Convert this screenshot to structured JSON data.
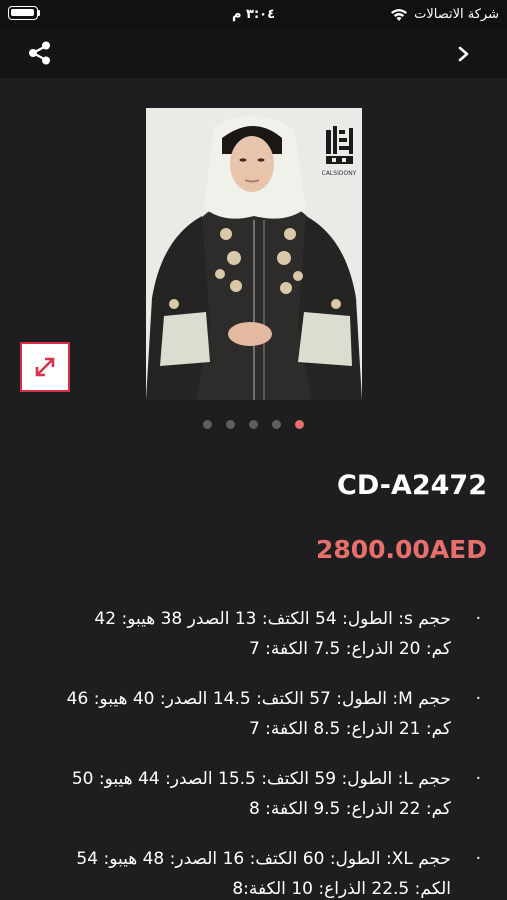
{
  "status_bar": {
    "carrier": "شركة الاتصالات",
    "time": "٣:٠٤ م"
  },
  "nav": {
    "back_icon": "chevron-right-icon",
    "share_icon": "share-icon"
  },
  "product": {
    "image_logo_text": "CALSIDONY",
    "carousel_pages": 5,
    "active_page": 5,
    "code": "CD-A2472",
    "price": "2800.00AED"
  },
  "sizes": [
    {
      "line1": "حجم s:  الطول: 54 الكتف: 13 الصدر 38 هيبو: 42",
      "line2": "كم: 20 الذراع: 7.5 الكفة: 7"
    },
    {
      "line1": "حجم M: الطول: 57 الكتف: 14.5 الصدر: 40 هيبو: 46",
      "line2": "كم: 21 الذراع: 8.5 الكفة: 7"
    },
    {
      "line1": "حجم L: الطول: 59 الكتف: 15.5 الصدر: 44 هيبو: 50",
      "line2": "كم: 22 الذراع: 9.5 الكفة: 8"
    },
    {
      "line1": "حجم XL: الطول: 60 الكتف: 16 الصدر: 48 هيبو: 54",
      "line2": "الكم: 22.5 الذراع: 10 الكفة:8"
    }
  ],
  "colors": {
    "accent": "#e8706c",
    "background": "#1e1e20",
    "expand_border": "#d8304a"
  }
}
